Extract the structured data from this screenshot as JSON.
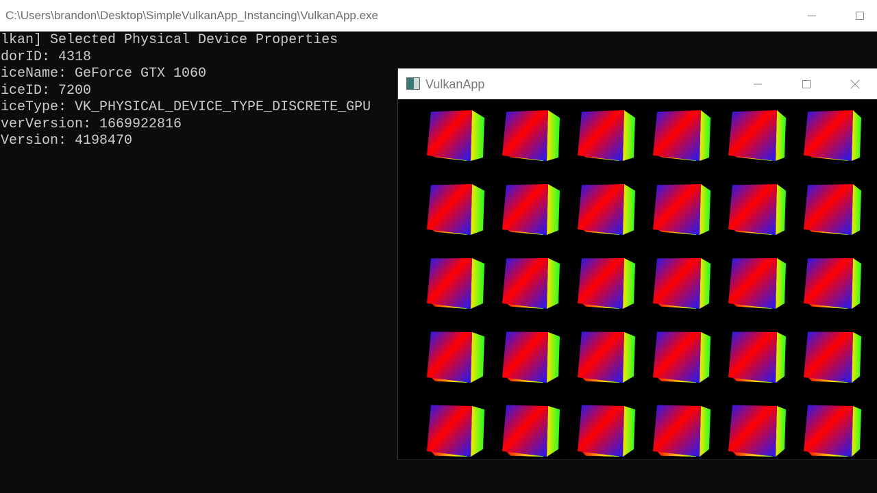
{
  "console": {
    "title": "C:\\Users\\brandon\\Desktop\\SimpleVulkanApp_Instancing\\VulkanApp.exe",
    "lines": [
      "lkan] Selected Physical Device Properties",
      "dorID: 4318",
      "iceName: GeForce GTX 1060",
      "iceID: 7200",
      "iceType: VK_PHYSICAL_DEVICE_TYPE_DISCRETE_GPU",
      "verVersion: 1669922816",
      "Version: 4198470"
    ]
  },
  "app_window": {
    "title": "VulkanApp",
    "render": {
      "rows": 5,
      "columns": 6,
      "object": "rotating-gradient-cube"
    }
  },
  "colors": {
    "console_bg": "#0c0c0c",
    "console_text": "#cccccc",
    "titlebar_bg": "#ffffff",
    "cube_red": "#ff0000",
    "cube_blue": "#1a1aff",
    "cube_green": "#22ff22",
    "cube_yellow": "#ffe600"
  },
  "icons": [
    "app-icon",
    "minimize-icon",
    "maximize-icon",
    "close-icon"
  ]
}
